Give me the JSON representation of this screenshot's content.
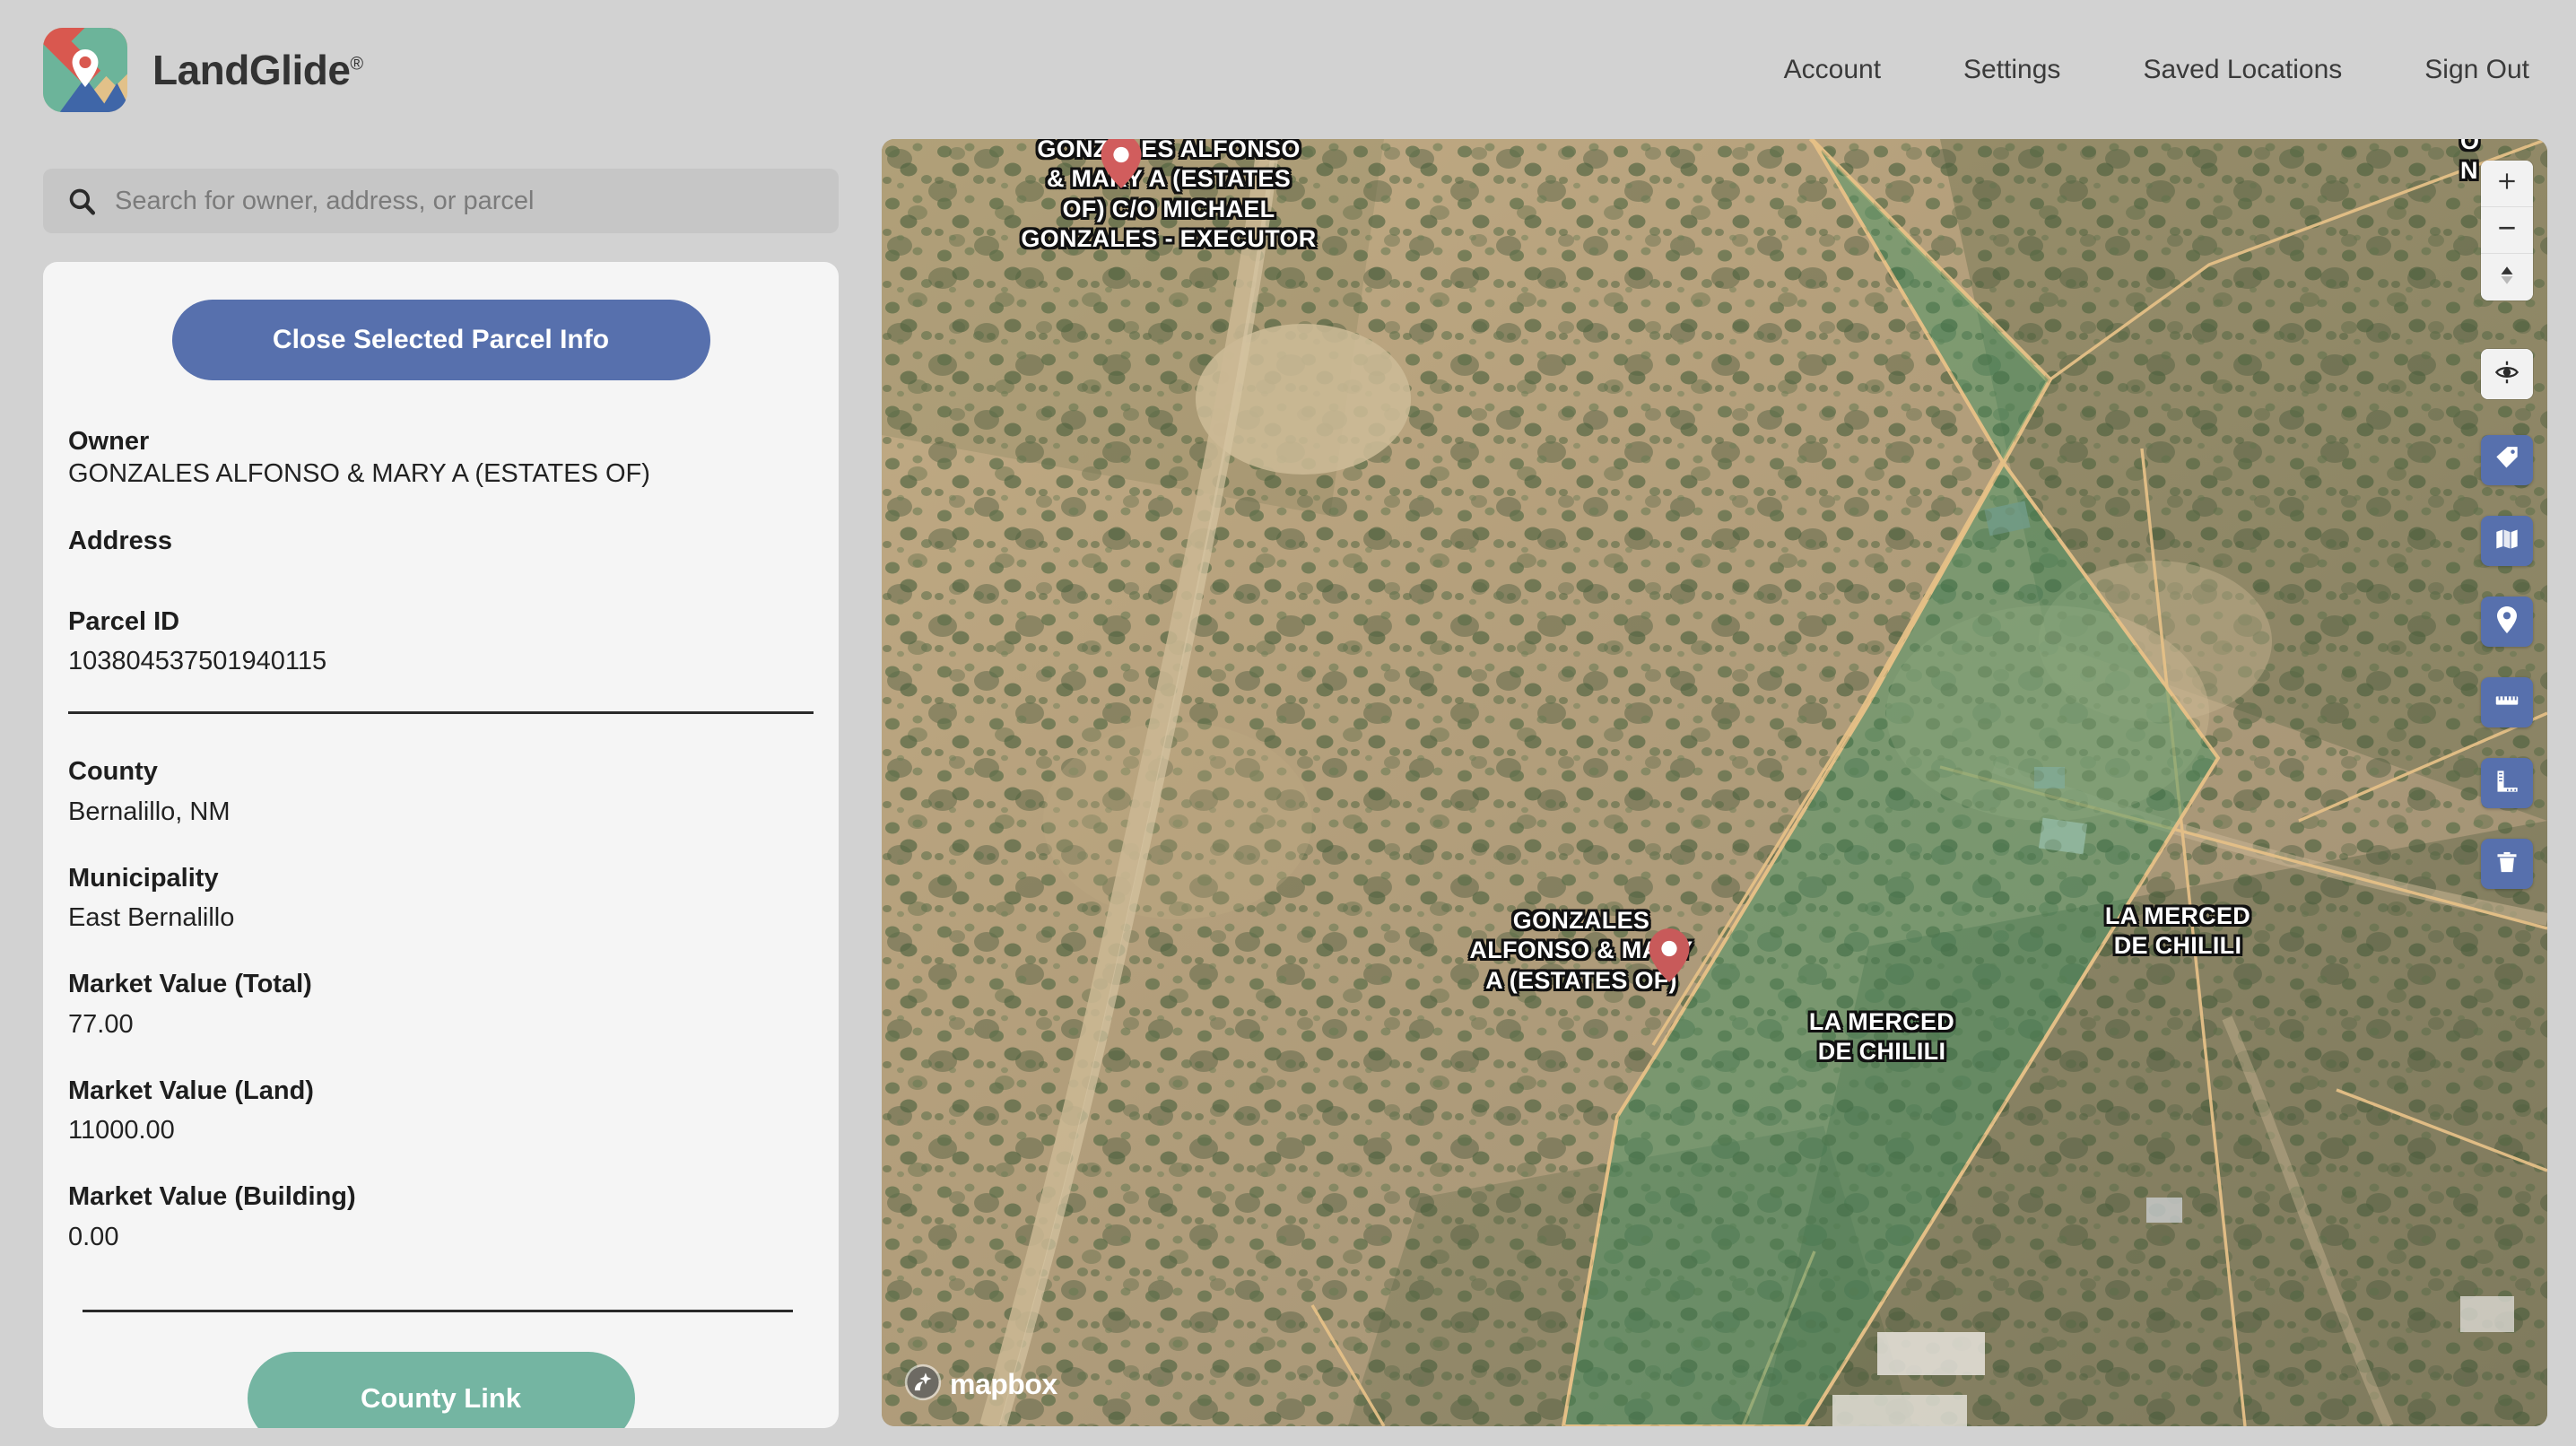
{
  "header": {
    "brand_name": "LandGlide",
    "brand_reg": "®",
    "logo_icon": "landglide-map-pin-logo",
    "nav": [
      {
        "label": "Account",
        "name": "nav-account"
      },
      {
        "label": "Settings",
        "name": "nav-settings"
      },
      {
        "label": "Saved Locations",
        "name": "nav-saved-locations"
      },
      {
        "label": "Sign Out",
        "name": "nav-sign-out"
      }
    ]
  },
  "search": {
    "placeholder": "Search for owner, address, or parcel",
    "value": "",
    "icon": "search-icon"
  },
  "panel": {
    "close_button_label": "Close Selected Parcel Info",
    "county_link_label": "County Link",
    "fields": [
      {
        "label": "Owner",
        "value": "GONZALES ALFONSO & MARY A (ESTATES OF)"
      },
      {
        "label": "Address",
        "value": ""
      },
      {
        "label": "Parcel ID",
        "value": "103804537501940115"
      },
      {
        "label": "County",
        "value": "Bernalillo, NM"
      },
      {
        "label": "Municipality",
        "value": "East Bernalillo"
      },
      {
        "label": "Market Value (Total)",
        "value": "77.00"
      },
      {
        "label": "Market Value (Land)",
        "value": "11000.00"
      },
      {
        "label": "Market Value (Building)",
        "value": "0.00"
      }
    ]
  },
  "map": {
    "attribution": "mapbox",
    "attribution_icon": "mapbox-logo-icon",
    "labels": [
      {
        "name": "parcel-label-top",
        "text": "GONZALES ALFONSO\n& MARY A (ESTATES\nOF) C/O MICHAEL\nGONZALES - EXECUTOR"
      },
      {
        "name": "parcel-label-selected",
        "text": "GONZALES\nALFONSO & MARY\nA (ESTATES OF)"
      },
      {
        "name": "parcel-label-la-merced-right",
        "text": "LA MERCED\nDE CHILILI"
      },
      {
        "name": "parcel-label-la-merced-bottom",
        "text": "LA MERCED\nDE CHILILI"
      }
    ],
    "controls": {
      "zoom_in": "zoom-in-icon",
      "zoom_out": "zoom-out-icon",
      "compass": "compass-icon",
      "geolocate": "geolocate-icon",
      "tools": [
        {
          "name": "parcel-label-toggle-button",
          "icon": "tag-icon"
        },
        {
          "name": "basemap-layers-button",
          "icon": "map-layers-icon"
        },
        {
          "name": "drop-pin-button",
          "icon": "location-pin-icon"
        },
        {
          "name": "measure-distance-button",
          "icon": "ruler-icon"
        },
        {
          "name": "measure-area-button",
          "icon": "area-ruler-icon"
        },
        {
          "name": "clear-button",
          "icon": "trash-icon"
        }
      ]
    },
    "colors": {
      "selected_parcel_fill": "#5fa07f",
      "parcel_boundary": "#e5c087",
      "marker": "#d15d5d",
      "tool_button": "#5770ad"
    }
  }
}
